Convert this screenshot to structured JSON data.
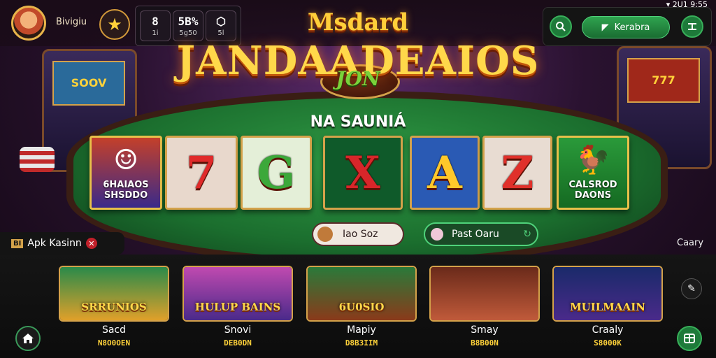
{
  "header": {
    "username": "Bivigiu",
    "stats": [
      {
        "value": "8",
        "label": "1i"
      },
      {
        "value": "5B%",
        "label": "5g50"
      },
      {
        "value": "",
        "label": "5l"
      }
    ],
    "promo_label": "Kerabra",
    "status_text": "2U1 9:55"
  },
  "logo": {
    "top": "Msdard",
    "main": "JANDAADEAIOS",
    "sub": "JON"
  },
  "table": {
    "title": "NA SAUNIÁ",
    "tiles": [
      {
        "type": "art",
        "caption": "6HAIAOS SHSDDO"
      },
      {
        "type": "glyph",
        "glyph": "7",
        "color": "#e02a2a",
        "bg": "#e8d8cc"
      },
      {
        "type": "glyph",
        "glyph": "G",
        "color": "#3ca83a",
        "bg": "#e4efd8"
      },
      {
        "type": "glyph",
        "glyph": "X",
        "color": "#d8262a",
        "bg": "#0f5a2a"
      },
      {
        "type": "glyph",
        "glyph": "A",
        "color": "#ffc82a",
        "bg": "#2a5ab4"
      },
      {
        "type": "glyph",
        "glyph": "Z",
        "color": "#e0302a",
        "bg": "#e8dcd2"
      },
      {
        "type": "art",
        "caption": "CALSROD DAONS"
      }
    ],
    "left_pill": "Iao Soz",
    "right_pill": "Past Oaru"
  },
  "apk": {
    "badge": "BI",
    "label": "Apk Kasinn"
  },
  "right_label": "Caary",
  "games": [
    {
      "title": "SRRUNIOS",
      "name": "Sacd",
      "sub": "N8O0OEN"
    },
    {
      "title": "HULUP BAINS",
      "name": "Snovi",
      "sub": "DEB0DN"
    },
    {
      "title": "6U0SIO",
      "name": "Mapiy",
      "sub": "D8B3IIM"
    },
    {
      "title": "",
      "name": "Smay",
      "sub": "B8B00N"
    },
    {
      "title": "MUILMAAIN",
      "name": "Craaly",
      "sub": "S8000K"
    }
  ],
  "colors": {
    "accent_green": "#2fa44f",
    "gold": "#d4a24a",
    "felt": "#1b6e2e"
  }
}
